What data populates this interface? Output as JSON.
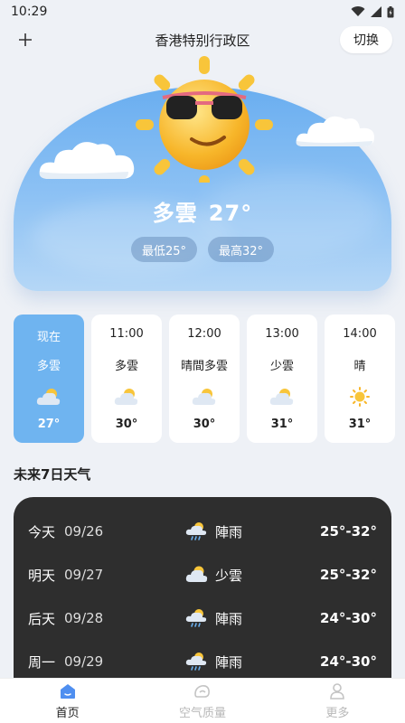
{
  "status_bar": {
    "time": "10:29"
  },
  "header": {
    "location": "香港特别行政区",
    "switch_label": "切换",
    "add_icon": "plus-icon"
  },
  "hero": {
    "condition": "多雲",
    "temperature": "27°",
    "min_label": "最低25°",
    "max_label": "最高32°",
    "sky_color": "#6aaef0"
  },
  "hourly": [
    {
      "time": "现在",
      "condition": "多雲",
      "icon": "partly-cloudy-icon",
      "temp": "27°"
    },
    {
      "time": "11:00",
      "condition": "多雲",
      "icon": "partly-cloudy-icon",
      "temp": "30°"
    },
    {
      "time": "12:00",
      "condition": "晴間多雲",
      "icon": "partly-cloudy-icon",
      "temp": "30°"
    },
    {
      "time": "13:00",
      "condition": "少雲",
      "icon": "partly-cloudy-icon",
      "temp": "31°"
    },
    {
      "time": "14:00",
      "condition": "晴",
      "icon": "sun-icon",
      "temp": "31°"
    }
  ],
  "forecast_title": "未来7日天气",
  "forecast": [
    {
      "day": "今天",
      "date": "09/26",
      "icon": "shower-icon",
      "condition": "陣雨",
      "range": "25°-32°"
    },
    {
      "day": "明天",
      "date": "09/27",
      "icon": "partly-cloudy-icon",
      "condition": "少雲",
      "range": "25°-32°"
    },
    {
      "day": "后天",
      "date": "09/28",
      "icon": "shower-icon",
      "condition": "陣雨",
      "range": "24°-30°"
    },
    {
      "day": "周一",
      "date": "09/29",
      "icon": "shower-icon",
      "condition": "陣雨",
      "range": "24°-30°"
    }
  ],
  "nav": [
    {
      "label": "首页",
      "icon": "home-icon",
      "active": true
    },
    {
      "label": "空气质量",
      "icon": "air-quality-icon",
      "active": false
    },
    {
      "label": "更多",
      "icon": "person-icon",
      "active": false
    }
  ],
  "colors": {
    "active_card": "#6fb4f0",
    "forecast_bg": "#2e2e2e",
    "page_bg": "#eef1f6"
  }
}
